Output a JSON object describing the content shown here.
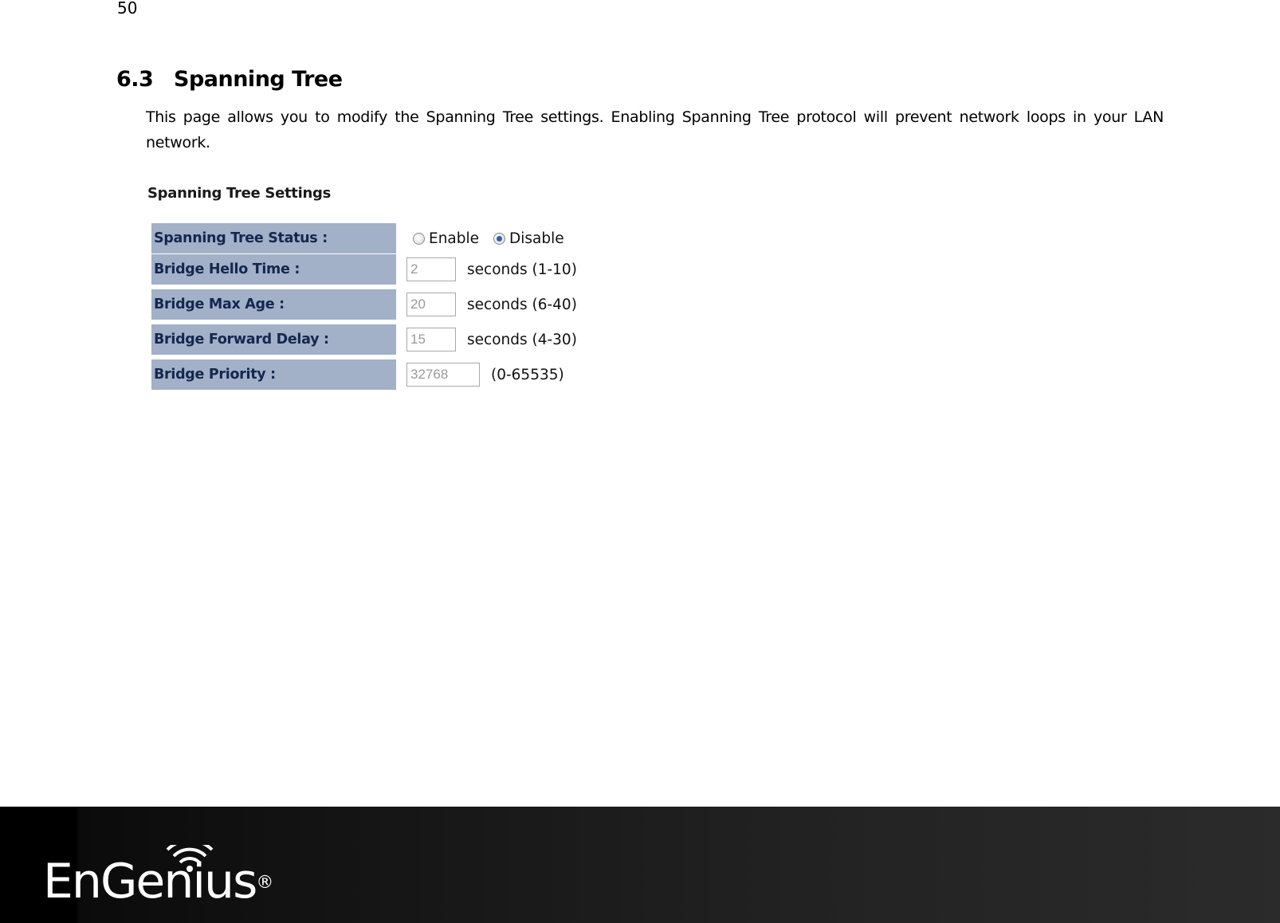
{
  "page_number": "50",
  "section": {
    "number": "6.3",
    "title": "Spanning Tree"
  },
  "description": "This page allows you to modify the Spanning Tree settings. Enabling Spanning Tree protocol will prevent network loops in your LAN network.",
  "settings": {
    "title": "Spanning Tree Settings",
    "status": {
      "label": "Spanning Tree Status :",
      "options": [
        {
          "label": "Enable",
          "checked": false
        },
        {
          "label": "Disable",
          "checked": true
        }
      ]
    },
    "rows": [
      {
        "label": "Bridge Hello Time :",
        "value": "2",
        "unit": "seconds (1-10)"
      },
      {
        "label": "Bridge Max Age :",
        "value": "20",
        "unit": "seconds (6-40)"
      },
      {
        "label": "Bridge Forward Delay :",
        "value": "15",
        "unit": "seconds (4-30)"
      },
      {
        "label": "Bridge Priority :",
        "value": "32768",
        "unit": "(0-65535)"
      }
    ]
  },
  "footer": {
    "brand": "EnGenius",
    "registered": "®"
  },
  "colors": {
    "label_bg": "#a2b0c8",
    "label_text": "#13284f",
    "footer_bg": "#1a1a1a"
  }
}
